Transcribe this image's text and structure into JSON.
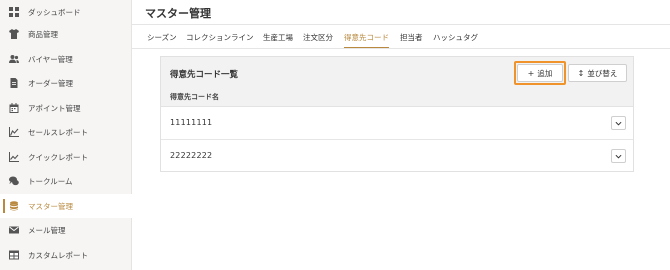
{
  "sidebar": {
    "items": [
      {
        "label": "ダッシュボード",
        "icon": "dashboard-icon",
        "active": false
      },
      {
        "label": "商品管理",
        "icon": "tshirt-icon",
        "active": false
      },
      {
        "label": "バイヤー管理",
        "icon": "users-icon",
        "active": false
      },
      {
        "label": "オーダー管理",
        "icon": "document-icon",
        "active": false
      },
      {
        "label": "アポイント管理",
        "icon": "calendar-icon",
        "active": false
      },
      {
        "label": "セールスレポート",
        "icon": "area-chart-icon",
        "active": false
      },
      {
        "label": "クイックレポート",
        "icon": "line-chart-icon",
        "active": false
      },
      {
        "label": "トークルーム",
        "icon": "chat-icon",
        "active": false
      },
      {
        "label": "マスター管理",
        "icon": "database-icon",
        "active": true
      },
      {
        "label": "メール管理",
        "icon": "mail-icon",
        "active": false
      },
      {
        "label": "カスタムレポート",
        "icon": "table-icon",
        "active": false
      }
    ]
  },
  "header": {
    "title": "マスター管理"
  },
  "tabs": [
    {
      "label": "シーズン",
      "active": false
    },
    {
      "label": "コレクションライン",
      "active": false
    },
    {
      "label": "生産工場",
      "active": false
    },
    {
      "label": "注文区分",
      "active": false
    },
    {
      "label": "得意先コード",
      "active": true
    },
    {
      "label": "担当者",
      "active": false
    },
    {
      "label": "ハッシュタグ",
      "active": false
    }
  ],
  "panel": {
    "title": "得意先コード一覧",
    "column_header": "得意先コード名",
    "add_label": "追加",
    "sort_label": "並び替え",
    "rows": [
      {
        "value": "11111111"
      },
      {
        "value": "22222222"
      }
    ]
  },
  "colors": {
    "accent": "#b8893f",
    "highlight": "#f0932b",
    "sidebar_bg": "#f6f5f4"
  }
}
